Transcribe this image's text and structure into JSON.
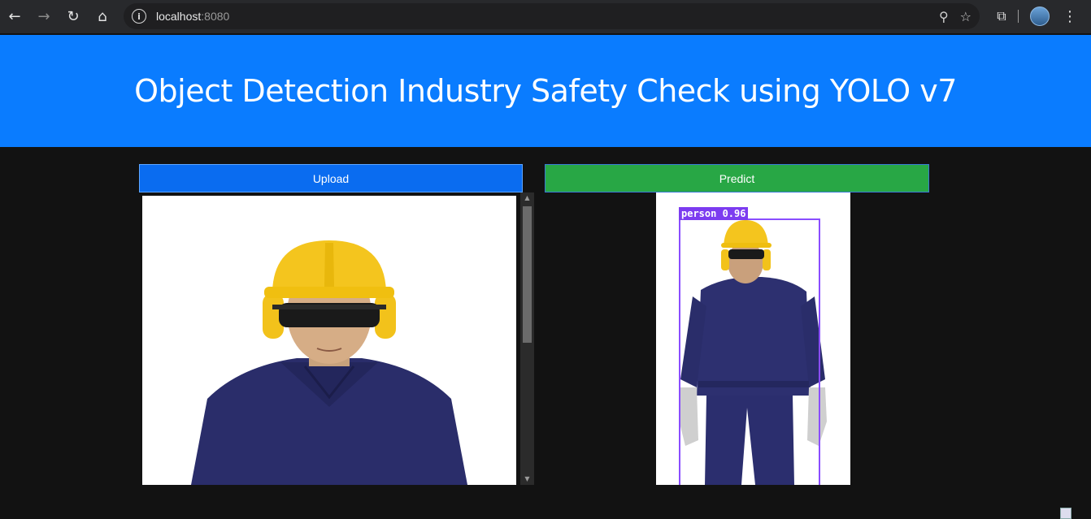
{
  "browser": {
    "url_host": "localhost",
    "url_port": ":8080"
  },
  "header": {
    "title": "Object Detection Industry Safety Check using YOLO v7"
  },
  "actions": {
    "upload_label": "Upload",
    "predict_label": "Predict"
  },
  "result": {
    "detection_label": "person 0.96"
  },
  "colors": {
    "header_bg": "#0a7cff",
    "upload_bg": "#0a6cf0",
    "predict_bg": "#28a745",
    "box_color": "#8a4dff"
  }
}
